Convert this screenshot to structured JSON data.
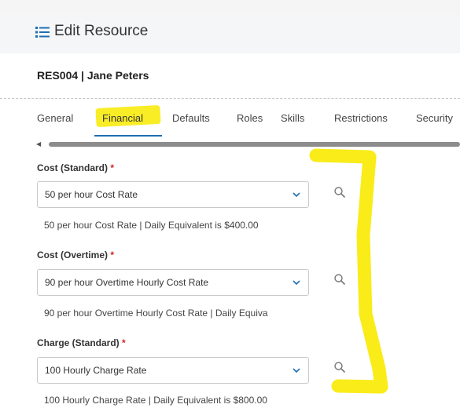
{
  "header": {
    "title": "Edit Resource",
    "icon": "list-icon"
  },
  "record": {
    "label": "RES004 | Jane Peters"
  },
  "tabs": [
    {
      "label": "General"
    },
    {
      "label": "Financial",
      "active": true
    },
    {
      "label": "Defaults"
    },
    {
      "label": "Roles"
    },
    {
      "label": "Skills"
    },
    {
      "label": "Restrictions"
    },
    {
      "label": "Security"
    }
  ],
  "fields": [
    {
      "label": "Cost (Standard)",
      "required": "*",
      "value": "50 per hour Cost Rate",
      "helper": "50 per hour Cost Rate | Daily Equivalent is $400.00"
    },
    {
      "label": "Cost (Overtime)",
      "required": "*",
      "value": "90 per hour Overtime Hourly Cost Rate",
      "helper": "90 per hour Overtime Hourly Cost Rate | Daily Equiva"
    },
    {
      "label": "Charge (Standard)",
      "required": "*",
      "value": "100 Hourly Charge Rate",
      "helper": "100 Hourly Charge Rate | Daily Equivalent is $800.00"
    }
  ],
  "colors": {
    "accent": "#1f6fb2",
    "required": "#d21f1f",
    "highlight": "#f8ea00"
  }
}
